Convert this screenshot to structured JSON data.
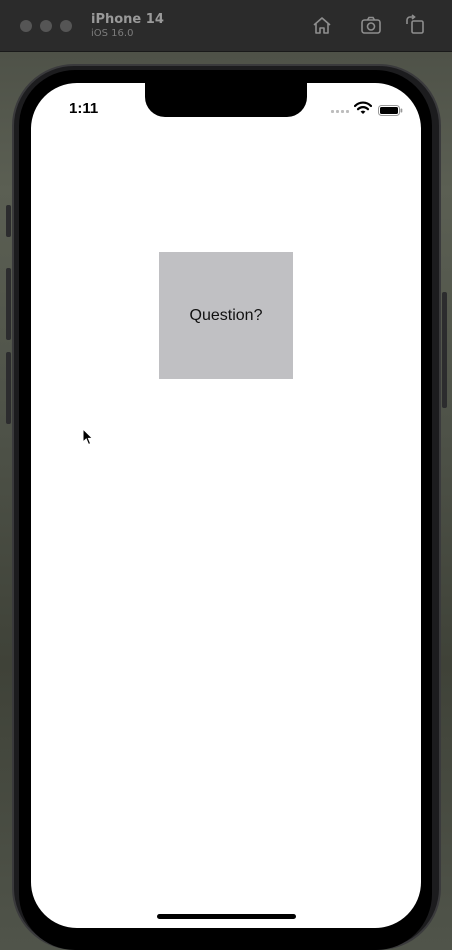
{
  "window": {
    "device_name": "iPhone 14",
    "os_version": "iOS 16.0",
    "toolbar_icons": [
      "home-icon",
      "screenshot-camera-icon",
      "rotate-icon"
    ]
  },
  "status_bar": {
    "time": "1:11",
    "icons": [
      "cellular-icon",
      "wifi-icon",
      "battery-icon"
    ]
  },
  "content": {
    "question_label": "Question?",
    "card_color": "#c0c0c3"
  },
  "colors": {
    "screen_background": "#ffffff",
    "titlebar_background": "#2b2b2b"
  }
}
